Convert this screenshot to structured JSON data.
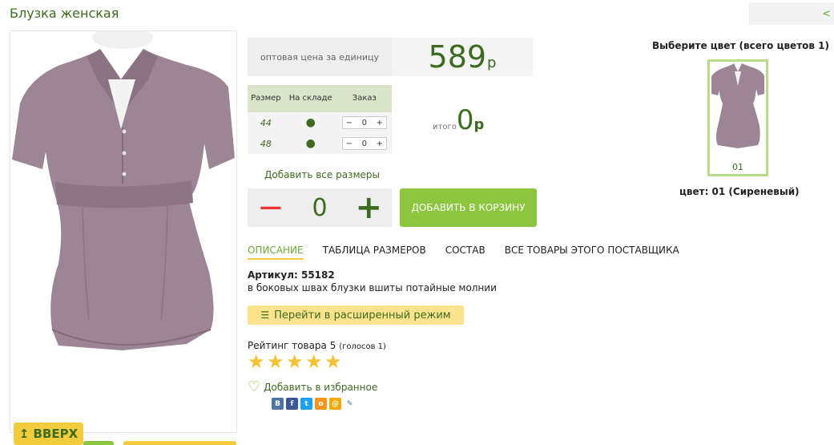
{
  "product": {
    "title": "Блузка женская",
    "back_link": "<"
  },
  "price": {
    "label": "оптовая цена за единицу",
    "value": "589",
    "currency": "р"
  },
  "sizes": {
    "headers": {
      "size": "Размер",
      "stock": "На складе",
      "order": "Заказ"
    },
    "rows": [
      {
        "size": "44",
        "stock": "●",
        "qty": "0"
      },
      {
        "size": "48",
        "stock": "●",
        "qty": "0"
      }
    ],
    "minus": "−",
    "plus": "+"
  },
  "total": {
    "label": "итого",
    "value": "0",
    "currency": "р"
  },
  "add_all_sizes": "Добавить все размеры",
  "quantity": {
    "minus": "−",
    "value": "0",
    "plus": "+"
  },
  "cart_button": "ДОБАВИТЬ В КОРЗИНУ",
  "tabs": [
    {
      "label": "ОПИСАНИЕ",
      "active": true
    },
    {
      "label": "ТАБЛИЦА РАЗМЕРОВ",
      "active": false
    },
    {
      "label": "СОСТАВ",
      "active": false
    },
    {
      "label": "ВСЕ ТОВАРЫ ЭТОГО ПОСТАВЩИКА",
      "active": false
    }
  ],
  "article": "Артикул: 55182",
  "description": "в боковых швах блузки вшиты потайные молнии",
  "advanced_mode": "Перейти в расширенный режим",
  "rating": {
    "label": "Рейтинг товара 5",
    "votes": "(голосов 1)",
    "stars": 5
  },
  "favorite": "Добавить в избранное",
  "social": [
    "В",
    "f",
    "t",
    "о",
    "@",
    "✎"
  ],
  "colors": {
    "heading": "Выберите цвет (всего цветов 1)",
    "swatch_code": "01",
    "selected": "цвет: 01 (Сиреневый)"
  },
  "up_button": "↥ ВВЕРХ",
  "palette": {
    "green": "#8cc63f",
    "dark_green": "#3d6b1f",
    "yellow": "#f2cc3c",
    "blouse": "#9c8595"
  }
}
